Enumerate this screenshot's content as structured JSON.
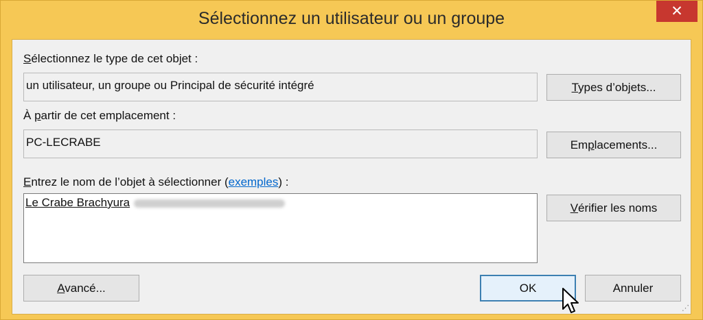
{
  "window": {
    "title": "Sélectionnez un utilisateur ou un groupe",
    "close_glyph": "✕"
  },
  "object_type": {
    "label_first": "S",
    "label_rest": "électionnez le type de cet objet :",
    "value": "un utilisateur, un groupe ou Principal de sécurité intégré",
    "button_first": "T",
    "button_rest": "ypes d’objets..."
  },
  "location": {
    "label_pre": "À ",
    "label_u": "p",
    "label_post": "artir de cet emplacement :",
    "value": "PC-LECRABE",
    "button_pre": "Em",
    "button_u": "p",
    "button_post": "lacements..."
  },
  "object_names": {
    "label_first": "E",
    "label_rest": "ntrez le nom de l’objet à sélectionner (",
    "link": "exemples",
    "label_end": ") :",
    "entry_name": "Le Crabe Brachyura"
  },
  "buttons": {
    "check_first": "V",
    "check_rest": "érifier les noms",
    "advanced_first": "A",
    "advanced_rest": "vancé...",
    "ok": "OK",
    "cancel": "Annuler"
  },
  "colors": {
    "title_bar": "#f6c855",
    "close": "#c7372f",
    "link": "#0066cc",
    "default_button_border": "#3c7fb1"
  }
}
